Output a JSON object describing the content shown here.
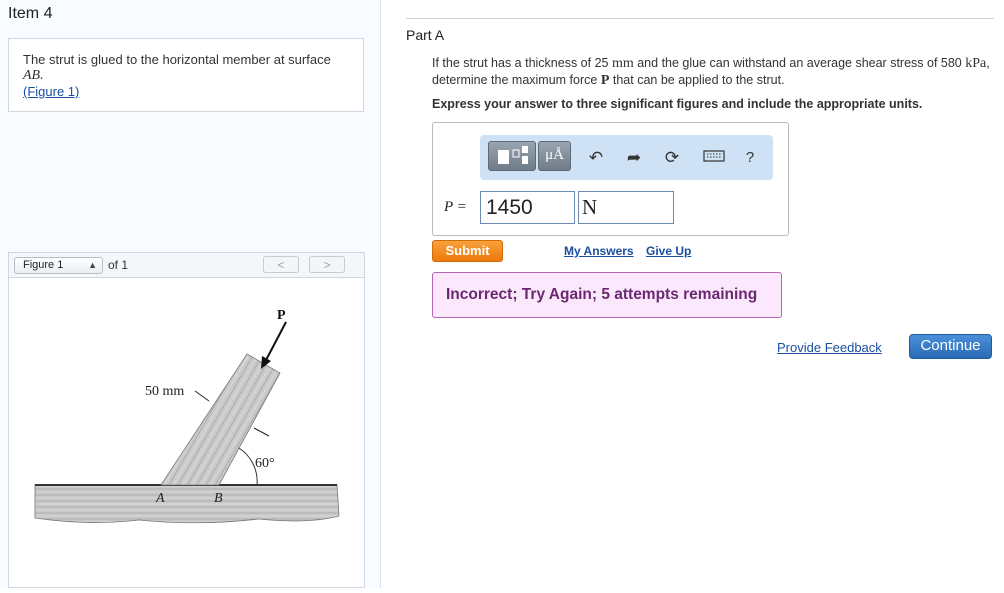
{
  "item_title": "Item 4",
  "intro": {
    "text": "The strut is glued to the horizontal member at surface",
    "surface": "AB.",
    "figure_link": "(Figure 1)"
  },
  "figure_nav": {
    "selected": "Figure 1",
    "of_label": "of 1",
    "prev_label": "<",
    "next_label": ">"
  },
  "figure": {
    "label_p": "P",
    "label_width": "50 mm",
    "label_angle": "60°",
    "label_a": "A",
    "label_b": "B"
  },
  "part": {
    "title": "Part A",
    "q_pre": "If the strut has a thickness of 25",
    "q_mm": "mm",
    "q_mid": "and the glue can withstand an average shear stress of 580",
    "q_kpa": "kPa",
    "q_mid2": ", determine the maximum force",
    "q_p": "P",
    "q_end": "that can be applied to the strut.",
    "instruction": "Express your answer to three significant figures and include the appropriate units."
  },
  "toolbar": {
    "units_label": "μÅ",
    "undo_icon": "undo-icon",
    "redo_icon": "redo-icon",
    "reset_icon": "reset-icon",
    "keyboard_icon": "keyboard-icon",
    "help_label": "?"
  },
  "answer": {
    "var_label": "P =",
    "value": "1450",
    "unit": "N"
  },
  "actions": {
    "submit": "Submit",
    "my_answers": "My Answers",
    "give_up": "Give Up"
  },
  "feedback": "Incorrect; Try Again; 5 attempts remaining",
  "footer": {
    "provide_feedback": "Provide Feedback",
    "continue": "Continue"
  },
  "colors": {
    "submit": "#f08a1e",
    "continue": "#2f74c0",
    "feedback_bg": "#fce8fc",
    "feedback_border": "#b564b4",
    "link": "#1a4fa0"
  }
}
